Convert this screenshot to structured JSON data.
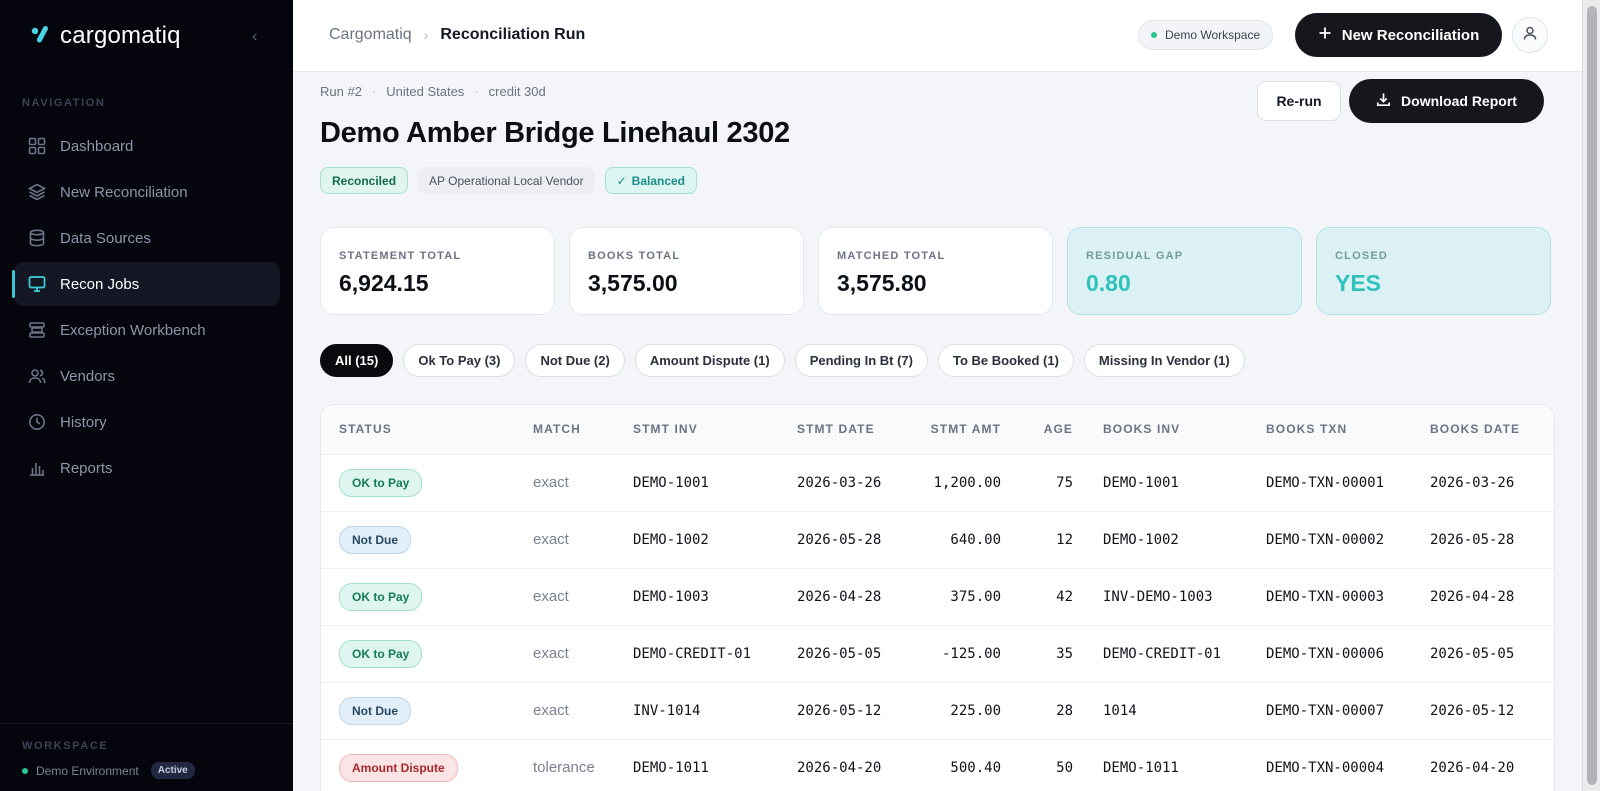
{
  "brand": {
    "name": "cargomatiq"
  },
  "sidebar": {
    "nav_title": "NAVIGATION",
    "items": [
      {
        "label": "Dashboard",
        "icon": "grid-icon"
      },
      {
        "label": "New Reconciliation",
        "icon": "layers-icon"
      },
      {
        "label": "Data Sources",
        "icon": "database-icon"
      },
      {
        "label": "Recon Jobs",
        "icon": "monitor-icon",
        "active": true
      },
      {
        "label": "Exception Workbench",
        "icon": "workbench-icon"
      },
      {
        "label": "Vendors",
        "icon": "users-icon"
      },
      {
        "label": "History",
        "icon": "clock-icon"
      },
      {
        "label": "Reports",
        "icon": "bar-chart-icon"
      }
    ],
    "workspace_title": "WORKSPACE",
    "workspace_name": "Demo Environment",
    "workspace_status": "Active"
  },
  "topbar": {
    "breadcrumb": [
      "Cargomatiq",
      "Reconciliation Run"
    ],
    "workspace_pill": "Demo Workspace",
    "new_button": "New Reconciliation"
  },
  "run": {
    "meta": [
      "Run  #2",
      "United States",
      "credit 30d"
    ],
    "title": "Demo Amber Bridge Linehaul 2302",
    "tags": [
      "Reconciled",
      "AP Operational Local Vendor",
      "Balanced"
    ],
    "rerun_label": "Re-run",
    "download_label": "Download Report"
  },
  "cards": [
    {
      "label": "STATEMENT TOTAL",
      "value": "6,924.15"
    },
    {
      "label": "BOOKS TOTAL",
      "value": "3,575.00"
    },
    {
      "label": "MATCHED TOTAL",
      "value": "3,575.80"
    },
    {
      "label": "RESIDUAL GAP",
      "value": "0.80"
    },
    {
      "label": "CLOSED",
      "value": "YES"
    }
  ],
  "filters": [
    "All (15)",
    "Ok To Pay (3)",
    "Not Due (2)",
    "Amount Dispute (1)",
    "Pending In Bt (7)",
    "To Be Booked (1)",
    "Missing In Vendor (1)"
  ],
  "table": {
    "columns": [
      "STATUS",
      "MATCH",
      "STMT INV",
      "STMT DATE",
      "STMT AMT",
      "AGE",
      "BOOKS INV",
      "BOOKS TXN",
      "BOOKS DATE"
    ],
    "rows": [
      [
        "OK to Pay",
        "exact",
        "DEMO-1001",
        "2026-03-26",
        "1,200.00",
        "75",
        "DEMO-1001",
        "DEMO-TXN-00001",
        "2026-03-26"
      ],
      [
        "Not Due",
        "exact",
        "DEMO-1002",
        "2026-05-28",
        "640.00",
        "12",
        "DEMO-1002",
        "DEMO-TXN-00002",
        "2026-05-28"
      ],
      [
        "OK to Pay",
        "exact",
        "DEMO-1003",
        "2026-04-28",
        "375.00",
        "42",
        "INV-DEMO-1003",
        "DEMO-TXN-00003",
        "2026-04-28"
      ],
      [
        "OK to Pay",
        "exact",
        "DEMO-CREDIT-01",
        "2026-05-05",
        "-125.00",
        "35",
        "DEMO-CREDIT-01",
        "DEMO-TXN-00006",
        "2026-05-05"
      ],
      [
        "Not Due",
        "exact",
        "INV-1014",
        "2026-05-12",
        "225.00",
        "28",
        "1014",
        "DEMO-TXN-00007",
        "2026-05-12"
      ],
      [
        "Amount Dispute",
        "tolerance",
        "DEMO-1011",
        "2026-04-20",
        "500.40",
        "50",
        "DEMO-1011",
        "DEMO-TXN-00004",
        "2026-04-20"
      ]
    ]
  },
  "colors": {
    "accent": "#35c7d8",
    "teal": "#2fc2bd",
    "dark": "#15171d",
    "sidebar": "#05060d"
  }
}
